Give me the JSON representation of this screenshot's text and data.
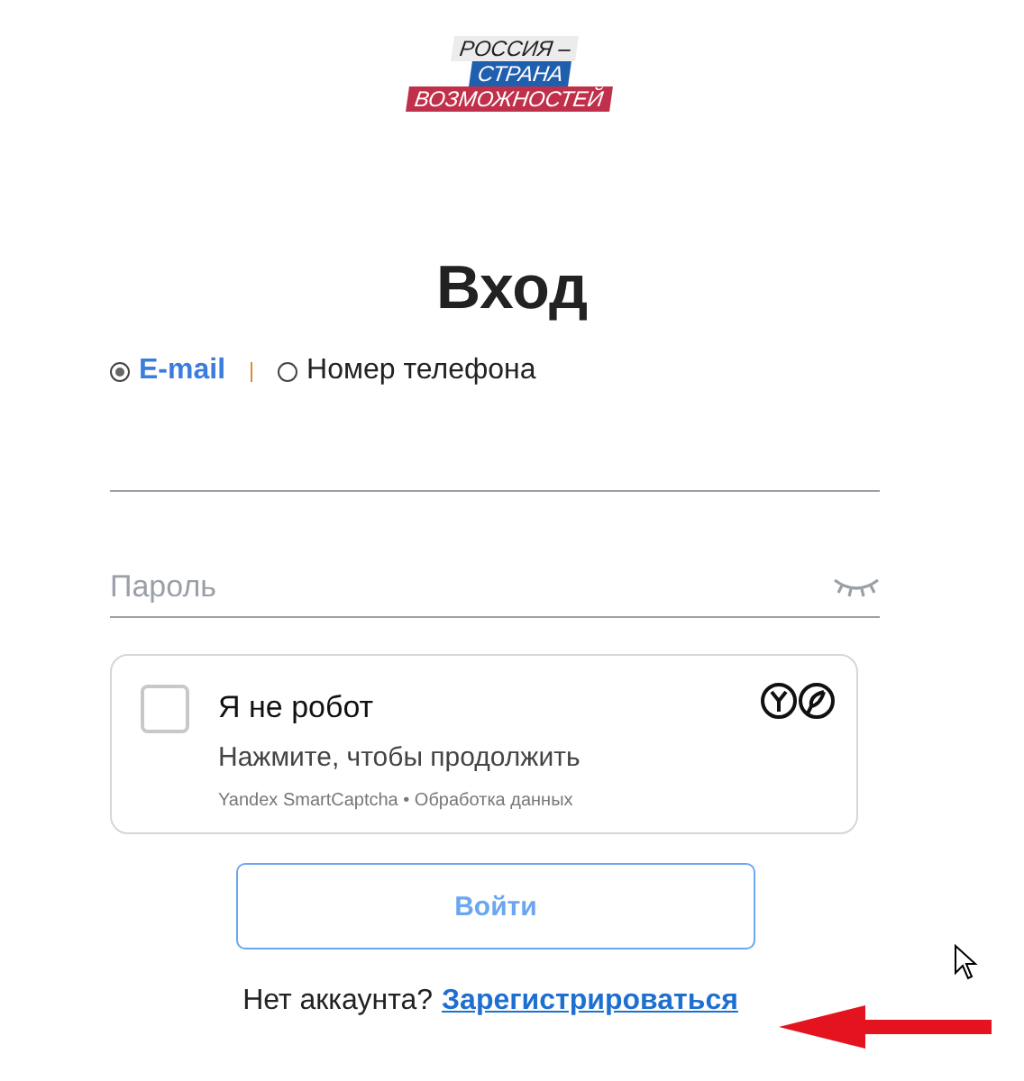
{
  "logo": {
    "lines": [
      {
        "text": "РОССИЯ –",
        "kind": "plain"
      },
      {
        "text": "СТРАНА",
        "kind": "blue"
      },
      {
        "text": "ВОЗМОЖНОСТЕЙ",
        "kind": "red"
      }
    ]
  },
  "title": "Вход",
  "login_type": [
    {
      "label": "E-mail",
      "selected": true
    },
    {
      "label": "Номер телефона",
      "selected": false
    }
  ],
  "password": {
    "placeholder": "Пароль"
  },
  "captcha": {
    "checked": false,
    "label": "Я не робот",
    "hint": "Нажмите, чтобы продолжить",
    "footer": "Yandex SmartCaptcha • Обработка данных"
  },
  "submit": {
    "label": "Войти"
  },
  "footer": {
    "text": "Нет аккаунта?",
    "link": "Зарегистрироваться"
  }
}
